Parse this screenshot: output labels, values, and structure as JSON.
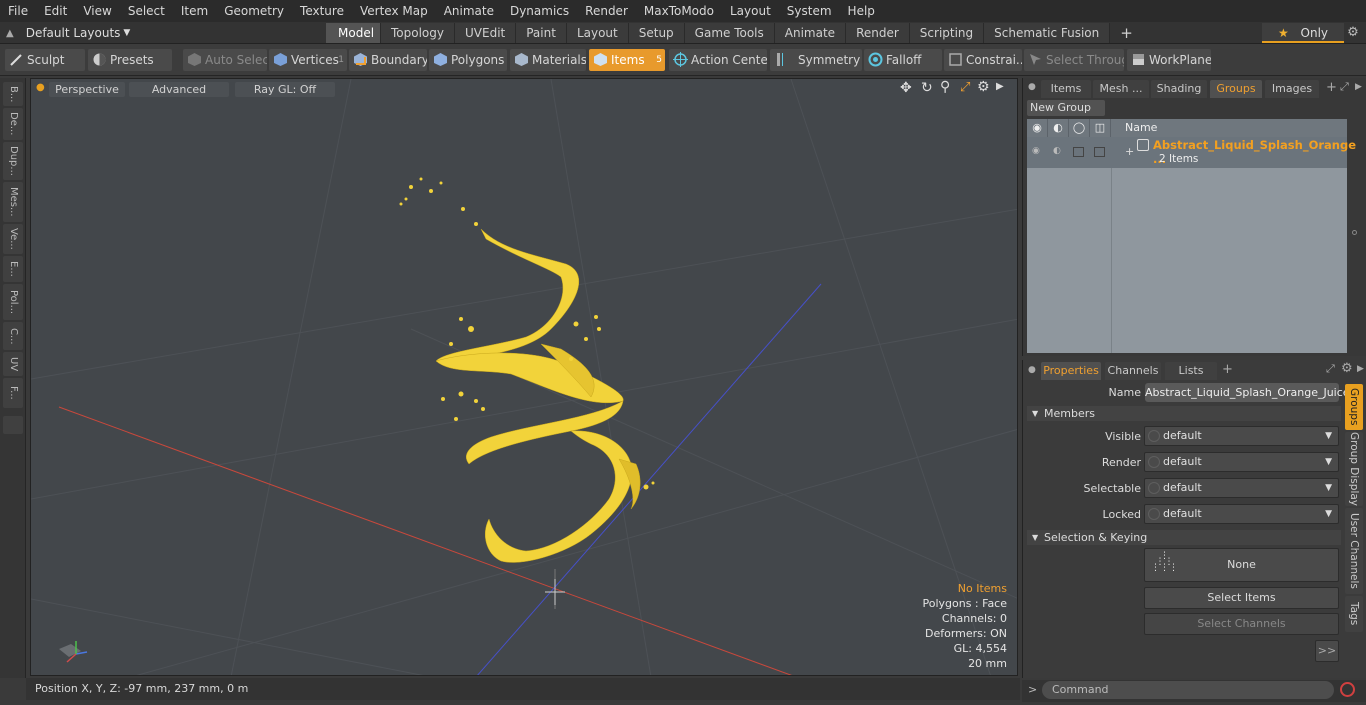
{
  "menu": [
    "File",
    "Edit",
    "View",
    "Select",
    "Item",
    "Geometry",
    "Texture",
    "Vertex Map",
    "Animate",
    "Dynamics",
    "Render",
    "MaxToModo",
    "Layout",
    "System",
    "Help"
  ],
  "layout_select": "Default Layouts",
  "mode_tabs": [
    "Model",
    "Topology",
    "UVEdit",
    "Paint",
    "Layout",
    "Setup",
    "Game Tools",
    "Animate",
    "Render",
    "Scripting",
    "Schematic Fusion"
  ],
  "active_mode_tab": "Model",
  "only_label": "Only",
  "toolbar": {
    "sculpt": "Sculpt",
    "presets": "Presets",
    "auto_select": "Auto Select",
    "vertices": "Vertices",
    "vertices_count": "1",
    "boundary": "Boundary",
    "polygons": "Polygons",
    "materials": "Materials",
    "items": "Items",
    "items_count": "5",
    "action_center": "Action Center",
    "symmetry": "Symmetry",
    "falloff": "Falloff",
    "constraints": "Constrai...",
    "select_through": "Select Through",
    "workplane": "WorkPlane"
  },
  "left_tabs": [
    "B...",
    "De...",
    "Dup...",
    "Mes...",
    "Ve...",
    "E...",
    "Pol...",
    "C...",
    "UV",
    "F..."
  ],
  "viewport": {
    "perspective": "Perspective",
    "advanced": "Advanced",
    "raygl": "Ray GL: Off",
    "info": {
      "no_items": "No Items",
      "polygons": "Polygons : Face",
      "channels": "Channels: 0",
      "deformers": "Deformers: ON",
      "gl": "GL: 4,554",
      "scale": "20 mm"
    }
  },
  "status": {
    "position": "Position X, Y, Z:  -97 mm, 237 mm, 0 m"
  },
  "groups_panel": {
    "tabs": [
      "Items",
      "Mesh ...",
      "Shading",
      "Groups",
      "Images"
    ],
    "active_tab": "Groups",
    "new_group": "New Group",
    "name_col": "Name",
    "group_name": "Abstract_Liquid_Splash_Orange ...",
    "group_count": "2 Items"
  },
  "properties": {
    "tabs": [
      "Properties",
      "Channels",
      "Lists"
    ],
    "active_tab": "Properties",
    "name_label": "Name",
    "name_value": "Abstract_Liquid_Splash_Orange_Juice",
    "members_section": "Members",
    "fields": [
      {
        "label": "Visible",
        "value": "default"
      },
      {
        "label": "Render",
        "value": "default"
      },
      {
        "label": "Selectable",
        "value": "default"
      },
      {
        "label": "Locked",
        "value": "default"
      }
    ],
    "sel_section": "Selection & Keying",
    "none_btn": "None",
    "select_items": "Select Items",
    "select_channels": "Select Channels",
    "more": ">>",
    "side_tabs": [
      "Groups",
      "Group Display",
      "User Channels",
      "Tags"
    ]
  },
  "command_placeholder": "Command",
  "colors": {
    "accent": "#e8a020",
    "splash": "#f2d33a",
    "viewport_bg": "#43474b"
  }
}
